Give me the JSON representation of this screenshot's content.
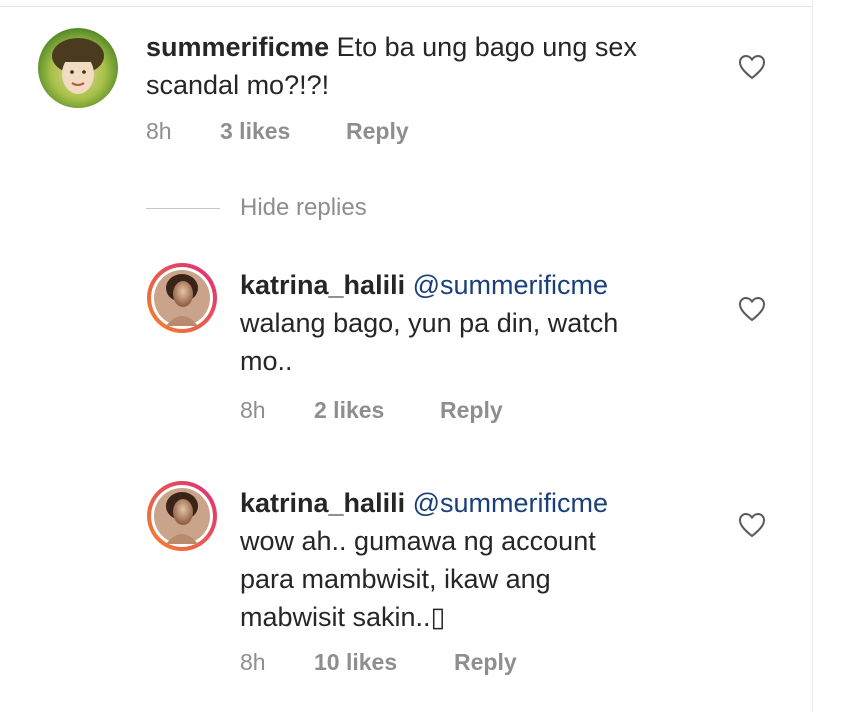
{
  "comments": [
    {
      "username": "summerificme",
      "mention": "",
      "body_lines": [
        "Eto ba ung bago ung sex",
        "scandal mo?!?!"
      ],
      "time": "8h",
      "likes": "3 likes",
      "reply": "Reply",
      "avatar": "avatar-photo-green"
    }
  ],
  "hide_replies": "Hide replies",
  "replies": [
    {
      "username": "katrina_halili",
      "mention": "@summerificme",
      "body_lines": [
        "walang bago, yun pa din, watch",
        "mo.."
      ],
      "time": "8h",
      "likes": "2 likes",
      "reply": "Reply"
    },
    {
      "username": "katrina_halili",
      "mention": "@summerificme",
      "body_lines": [
        "wow ah.. gumawa ng account",
        "para mambwisit, ikaw ang",
        "mabwisit sakin..▯"
      ],
      "time": "8h",
      "likes": "10 likes",
      "reply": "Reply"
    }
  ],
  "icons": {
    "like": "heart-outline-icon",
    "story_ring": "story-ring-gradient"
  },
  "colors": {
    "text": "#262626",
    "muted": "#8e8e8e",
    "mention": "#1a3f7a",
    "story_ring_start": "#f58529",
    "story_ring_end": "#dd2a7b"
  }
}
